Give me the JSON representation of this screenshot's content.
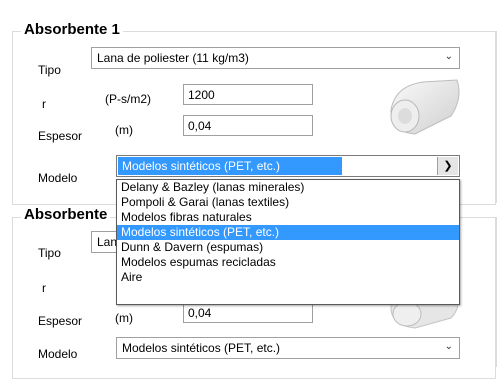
{
  "absorbente1": {
    "title": "Absorbente 1",
    "tipo_label": "Tipo",
    "tipo_value": "Lana de poliester (11 kg/m3)",
    "r_label": "r",
    "r_unit": "(P-s/m2)",
    "r_value": "1200",
    "espesor_label": "Espesor",
    "espesor_unit": "(m)",
    "espesor_value": "0,04",
    "modelo_label": "Modelo",
    "modelo_value": "Modelos sintéticos (PET, etc.)"
  },
  "dropdown": {
    "options": [
      "Delany & Bazley (lanas minerales)",
      "Pompoli & Garai (lanas textiles)",
      "Modelos fibras naturales",
      "Modelos sintéticos (PET, etc.)",
      "Dunn & Davern (espumas)",
      "Modelos espumas recicladas",
      "Aire"
    ],
    "selected_index": 3
  },
  "absorbente2": {
    "title": "Absorbente",
    "tipo_label": "Tipo",
    "tipo_value": "Lan",
    "r_label": "r",
    "espesor_label": "Espesor",
    "espesor_unit": "(m)",
    "espesor_value": "0,04",
    "modelo_label": "Modelo",
    "modelo_value": "Modelos sintéticos (PET, etc.)"
  },
  "icons": {
    "dropdown_arrow": "chevron-down-icon",
    "material_image": "foam-roll-image"
  }
}
